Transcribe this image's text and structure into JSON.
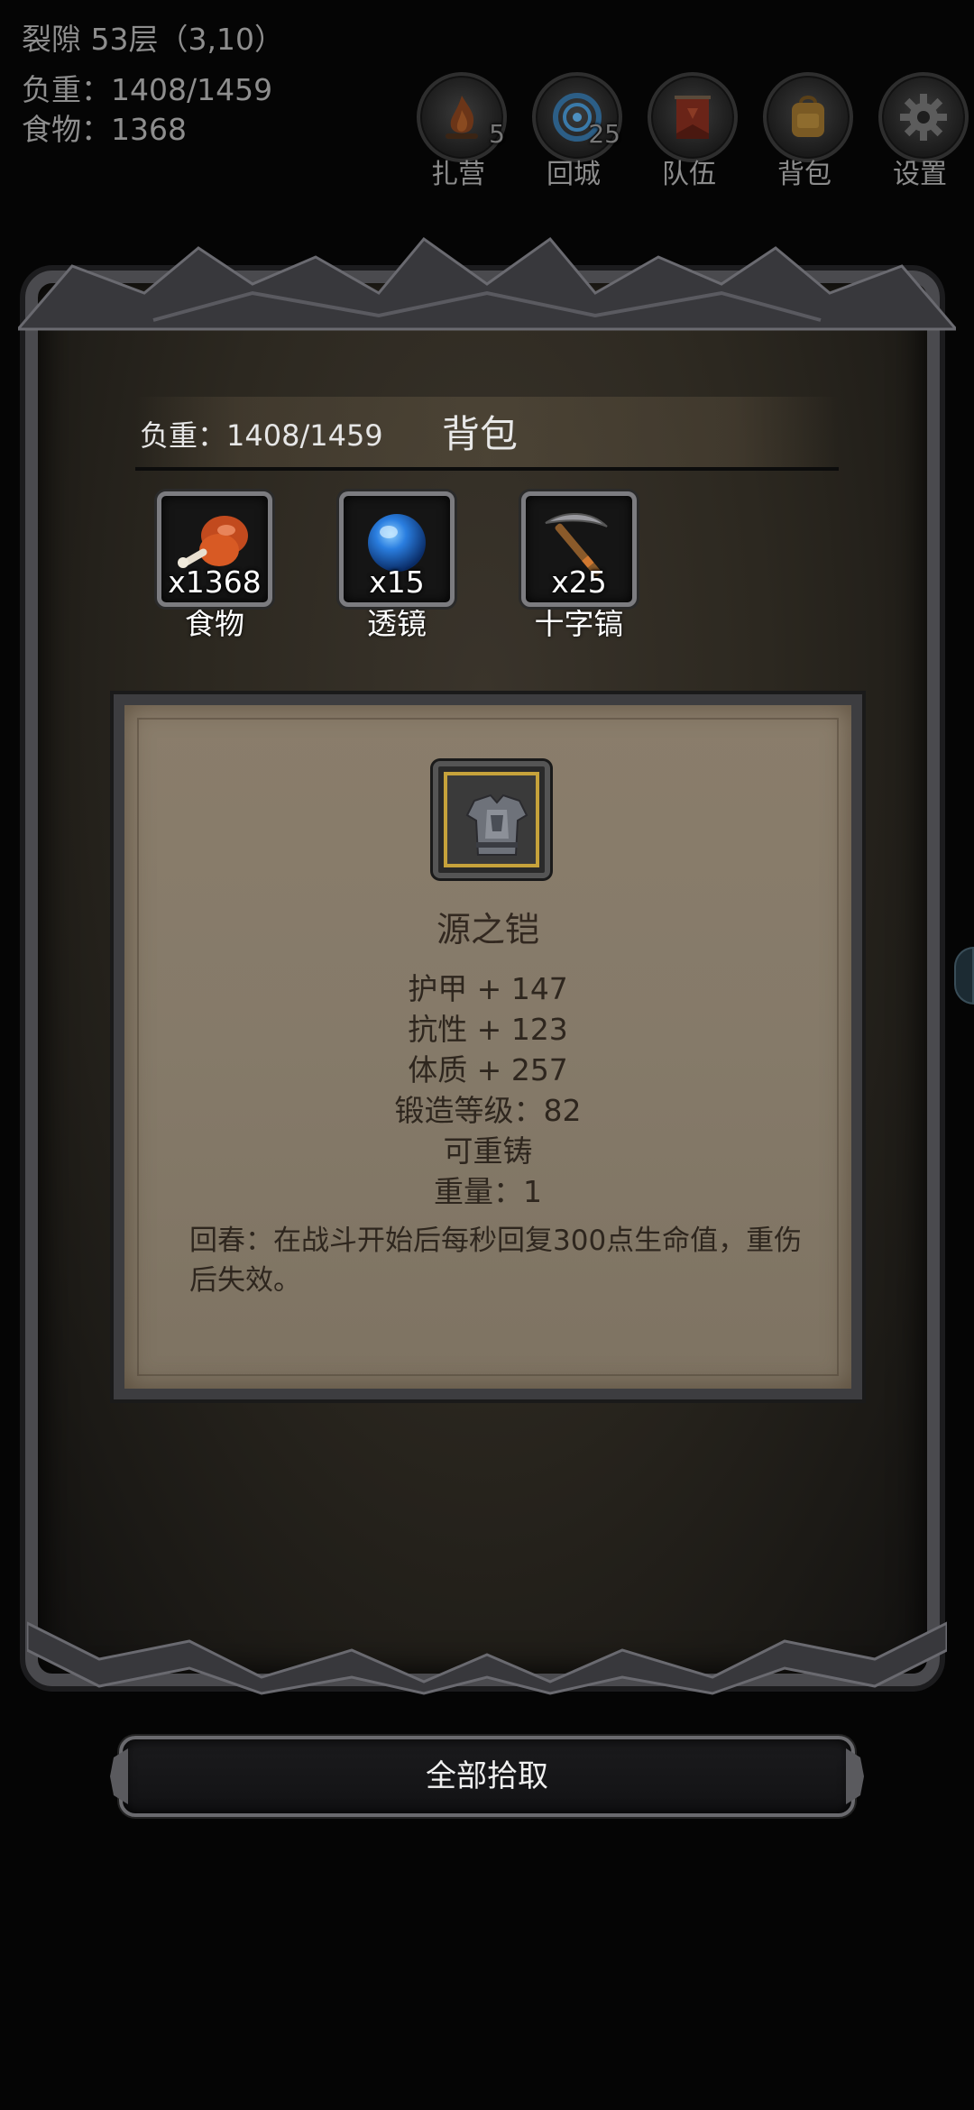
{
  "status": {
    "floor": "裂隙 53层（3,10）",
    "weight": "负重：1408/1459",
    "food": "食物：1368"
  },
  "menu": [
    {
      "label": "扎营",
      "badge": "5",
      "icon": "campfire-icon",
      "color": "#7a3d1a"
    },
    {
      "label": "回城",
      "badge": "25",
      "icon": "portal-icon",
      "color": "#2c6ea6"
    },
    {
      "label": "队伍",
      "badge": "",
      "icon": "banner-icon",
      "color": "#7a2a1e"
    },
    {
      "label": "背包",
      "badge": "",
      "icon": "backpack-icon",
      "color": "#8a6a2a"
    },
    {
      "label": "设置",
      "badge": "",
      "icon": "gear-icon",
      "color": "#6a6a6a"
    }
  ],
  "panel": {
    "title": "背包",
    "weight": "负重：1408/1459",
    "slots": [
      {
        "count": "x1368",
        "label": "食物",
        "icon": "meat-icon"
      },
      {
        "count": "x15",
        "label": "透镜",
        "icon": "lens-orb-icon"
      },
      {
        "count": "x25",
        "label": "十字镐",
        "icon": "pickaxe-icon"
      }
    ]
  },
  "item": {
    "name": "源之铠",
    "icon": "armor-icon",
    "frame_color": "#c6a23b",
    "stats": [
      "护甲 + 147",
      "抗性 + 123",
      "体质 + 257",
      "锻造等级：82",
      "可重铸",
      "重量：1"
    ],
    "description": "回春：在战斗开始后每秒回复300点生命值，重伤后失效。"
  },
  "pickup_button": "全部拾取"
}
